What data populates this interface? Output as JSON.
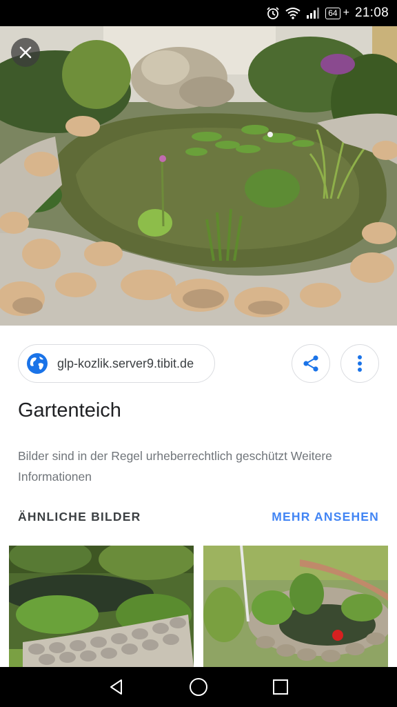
{
  "status_bar": {
    "battery": "64",
    "time": "21:08",
    "icons": [
      "alarm-icon",
      "wifi-icon",
      "signal-icon",
      "battery-icon"
    ]
  },
  "hero": {
    "close_icon": "close-icon"
  },
  "source": {
    "domain": "glp-kozlik.server9.tibit.de",
    "icon": "globe-icon"
  },
  "actions": {
    "share_icon": "share-icon",
    "more_icon": "more-vert-icon"
  },
  "title": "Gartenteich",
  "copyright_notice": "Bilder sind in der Regel urheberrechtlich geschützt Weitere Informationen",
  "related": {
    "label": "ÄHNLICHE BILDER",
    "more_link": "MEHR ANSEHEN"
  },
  "navigation": {
    "back_icon": "back-icon",
    "home_icon": "home-icon",
    "recents_icon": "recents-icon"
  },
  "colors": {
    "accent": "#4285f4",
    "text_primary": "#202124",
    "text_secondary": "#70757a"
  }
}
